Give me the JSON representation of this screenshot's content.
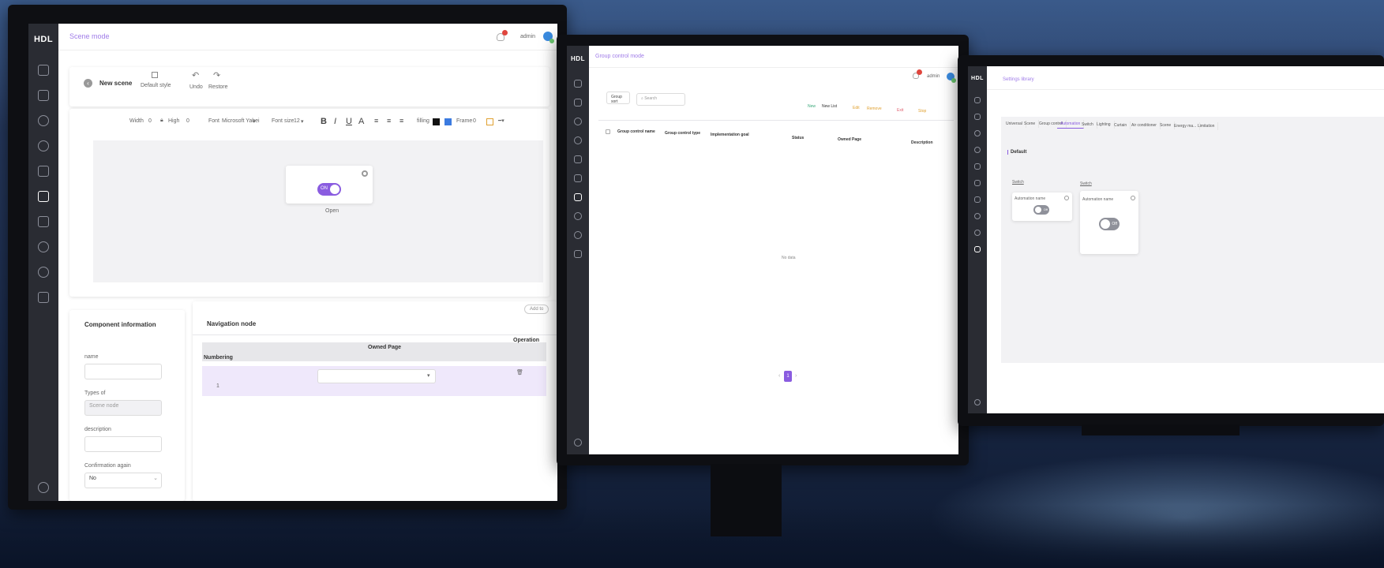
{
  "brand": {
    "logo": "HDL",
    "accent": "#8a5ce0",
    "sidebar_bg": "#2a2c33",
    "alert": "#e0453d"
  },
  "monitor1": {
    "topbar": {
      "title": "Scene mode",
      "user": "admin"
    },
    "toolbar": {
      "back_icon": "chevron-left-icon",
      "title": "New scene",
      "default_style": "Default style",
      "undo": "Undo",
      "restore": "Restore"
    },
    "format_bar": {
      "width_label": "Width",
      "width_value": "0",
      "high_label": "High",
      "high_value": "0",
      "font_label": "Font",
      "font_value": "Microsoft Yahei",
      "fontsize_label": "Font size",
      "fontsize_value": "12",
      "bold": "B",
      "italic": "I",
      "underline": "U",
      "color": "A",
      "filling": "filling",
      "frame": "Frame",
      "frame_value": "0"
    },
    "canvas": {
      "toggle_label": "ON",
      "caption": "Open",
      "toggle_state": "on"
    },
    "component_info": {
      "title": "Component information",
      "name_label": "name",
      "name_value": "",
      "types_label": "Types of",
      "types_value": "Scene node",
      "description_label": "description",
      "description_value": "",
      "confirmation_label": "Confirmation again",
      "confirmation_value": "No"
    },
    "navigation": {
      "title": "Navigation node",
      "add_button": "Add to",
      "columns": [
        "Numbering",
        "Owned Page",
        "Operation"
      ],
      "rows": [
        {
          "numbering": "1",
          "owned_page": ""
        }
      ]
    }
  },
  "monitor2": {
    "topbar": {
      "title": "Group control mode",
      "user": "admin"
    },
    "controls": {
      "group_select": "Group sort",
      "search_placeholder": "Search",
      "new": "New",
      "new_list": "New List",
      "edit": "Edit",
      "remove": "Remove",
      "exit": "Exit",
      "stop": "Stop"
    },
    "columns": [
      "Group control name",
      "Group control type",
      "Implementation goal",
      "Status",
      "Owned Page",
      "Description"
    ],
    "empty_text": "No data",
    "pagination": {
      "prev": "‹",
      "current": "1",
      "next": "›"
    }
  },
  "monitor3": {
    "topbar": {
      "title": "Settings library"
    },
    "tabs": [
      "Universal",
      "Scene",
      "Group control",
      "Automation",
      "Switch",
      "Lighting",
      "Curtain",
      "Air conditioner",
      "Scene",
      "Energy ma...",
      "Limitation"
    ],
    "active_tab": 3,
    "section_title": "Default",
    "cards": [
      {
        "label": "Switch",
        "name": "Automation name",
        "toggle_label": "Off",
        "toggle_state": "off"
      },
      {
        "label": "Switch",
        "name": "Automation name",
        "toggle_label": "Off",
        "toggle_state": "off"
      }
    ]
  }
}
